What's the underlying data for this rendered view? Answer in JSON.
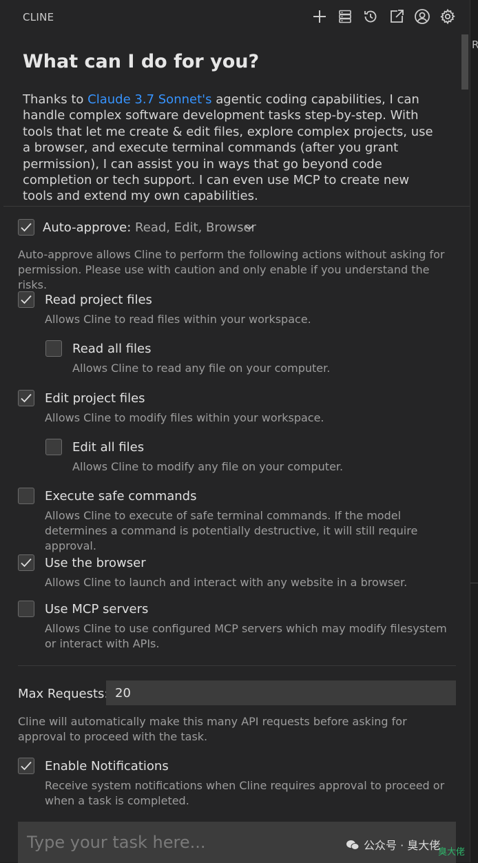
{
  "header": {
    "title": "CLINE",
    "icons": [
      "plus-icon",
      "server-icon",
      "history-icon",
      "popout-icon",
      "account-icon",
      "gear-icon"
    ]
  },
  "welcome": {
    "title": "What can I do for you?",
    "intro_before": "Thanks to ",
    "model_link": "Claude 3.7 Sonnet's",
    "intro_after": " agentic coding capabilities, I can handle complex software development tasks step-by-step. With tools that let me create & edit files, explore complex projects, use a browser, and execute terminal commands (after you grant permission), I can assist you in ways that go beyond code completion or tech support. I can even use MCP to create new tools and extend my own capabilities."
  },
  "auto_approve": {
    "checked": true,
    "label": "Auto-approve:",
    "values": "Read, Edit, Browser",
    "description": "Auto-approve allows Cline to perform the following actions without asking for permission. Please use with caution and only enable if you understand the risks.",
    "actions": [
      {
        "label": "Read project files",
        "description": "Allows Cline to read files within your workspace.",
        "checked": true
      },
      {
        "label": "Read all files",
        "description": "Allows Cline to read any file on your computer.",
        "checked": false
      },
      {
        "label": "Edit project files",
        "description": "Allows Cline to modify files within your workspace.",
        "checked": true
      },
      {
        "label": "Edit all files",
        "description": "Allows Cline to modify any file on your computer.",
        "checked": false
      },
      {
        "label": "Execute safe commands",
        "description": "Allows Cline to execute of safe terminal commands. If the model determines a command is potentially destructive, it will still require approval.",
        "checked": false
      },
      {
        "label": "Use the browser",
        "description": "Allows Cline to launch and interact with any website in a browser.",
        "checked": true
      },
      {
        "label": "Use MCP servers",
        "description": "Allows Cline to use configured MCP servers which may modify filesystem or interact with APIs.",
        "checked": false
      }
    ]
  },
  "max_requests": {
    "label": "Max Requests:",
    "value": "20",
    "description": "Cline will automatically make this many API requests before asking for approval to proceed with the task."
  },
  "notifications": {
    "checked": true,
    "label": "Enable Notifications",
    "description": "Receive system notifications when Cline requires approval to proceed or when a task is completed."
  },
  "task_input": {
    "placeholder": "Type your task here..."
  },
  "right_panel": {
    "letter": "R"
  },
  "watermark": {
    "text": "公众号 · 臭大佬",
    "corner_text": "臭大佬"
  },
  "colors": {
    "link": "#3794ff",
    "sidebar_bg": "#252526",
    "input_bg": "#3c3c3c"
  }
}
